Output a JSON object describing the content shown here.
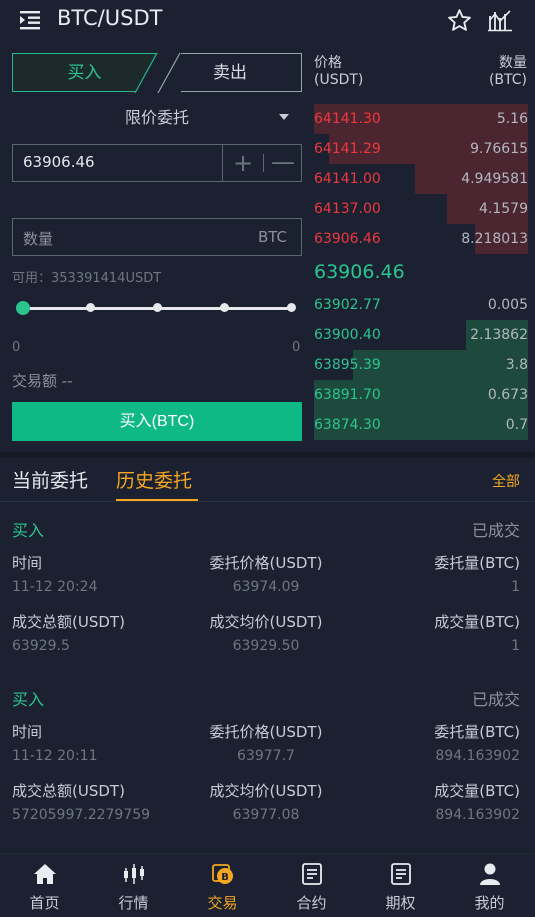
{
  "header": {
    "title": "BTC/USDT",
    "menu_icon": "menu-collapse-icon",
    "star_icon": "star-icon",
    "chart_icon": "chart-icon"
  },
  "form": {
    "buy_tab": "买入",
    "sell_tab": "卖出",
    "order_type": "限价委托",
    "price_value": "63906.46",
    "plus": "+",
    "minus": "—",
    "qty_placeholder": "数量",
    "qty_unit": "BTC",
    "available": "可用：353391414USDT",
    "slider_min": "0",
    "slider_max": "0",
    "slider_fraction": 0,
    "trade_amount": "交易额 --",
    "buy_button": "买入(BTC)"
  },
  "orderbook": {
    "price_header": [
      "价格",
      "(USDT)"
    ],
    "qty_header": [
      "数量",
      "(BTC)"
    ],
    "asks": [
      {
        "price": "64141.30",
        "qty": "5.16",
        "depth": 1.0
      },
      {
        "price": "64141.29",
        "qty": "9.76615",
        "depth": 0.93
      },
      {
        "price": "64141.00",
        "qty": "4.949581",
        "depth": 0.53
      },
      {
        "price": "64137.00",
        "qty": "4.1579",
        "depth": 0.38
      },
      {
        "price": "63906.46",
        "qty": "8.218013",
        "depth": 0.25
      }
    ],
    "last_price": "63906.46",
    "bids": [
      {
        "price": "63902.77",
        "qty": "0.005",
        "depth": 0.0
      },
      {
        "price": "63900.40",
        "qty": "2.13862",
        "depth": 0.29
      },
      {
        "price": "63895.39",
        "qty": "3.8",
        "depth": 0.82
      },
      {
        "price": "63891.70",
        "qty": "0.673",
        "depth": 1.0
      },
      {
        "price": "63874.30",
        "qty": "0.7",
        "depth": 1.0
      }
    ],
    "ask_color": "#f0373f",
    "bid_color": "#2bc48f"
  },
  "orders": {
    "tab_current": "当前委托",
    "tab_history": "历史委托",
    "all": "全部",
    "items": [
      {
        "side": "买入",
        "status": "已成交",
        "label_time": "时间",
        "label_price": "委托价格(USDT)",
        "label_amount": "委托量(BTC)",
        "time": "11-12 20:24",
        "price": "63974.09",
        "amount": "1",
        "label_total": "成交总额(USDT)",
        "label_avg": "成交均价(USDT)",
        "label_filled": "成交量(BTC)",
        "total": "63929.5",
        "avg": "63929.50",
        "filled": "1"
      },
      {
        "side": "买入",
        "status": "已成交",
        "label_time": "时间",
        "label_price": "委托价格(USDT)",
        "label_amount": "委托量(BTC)",
        "time": "11-12 20:11",
        "price": "63977.7",
        "amount": "894.163902",
        "label_total": "成交总额(USDT)",
        "label_avg": "成交均价(USDT)",
        "label_filled": "成交量(BTC)",
        "total": "57205997.2279759",
        "avg": "63977.08",
        "filled": "894.163902"
      }
    ]
  },
  "nav": {
    "items": [
      {
        "label": "首页",
        "icon": "home-icon"
      },
      {
        "label": "行情",
        "icon": "candlestick-icon"
      },
      {
        "label": "交易",
        "icon": "trade-coin-icon",
        "active": true
      },
      {
        "label": "合约",
        "icon": "contract-icon"
      },
      {
        "label": "期权",
        "icon": "options-icon"
      },
      {
        "label": "我的",
        "icon": "profile-icon"
      }
    ],
    "active_color": "#f5a623"
  }
}
